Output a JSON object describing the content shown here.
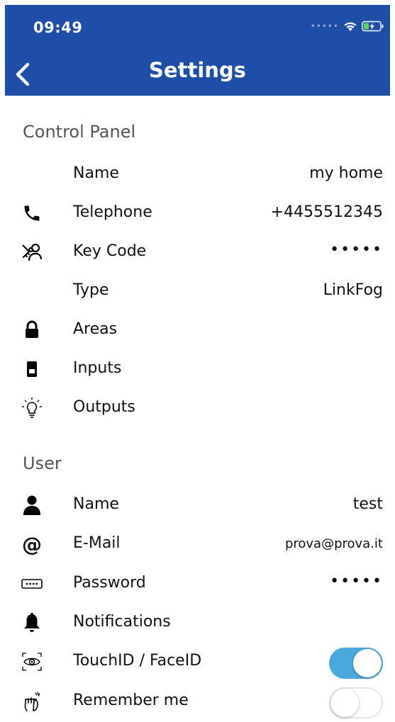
{
  "status_bar": {
    "time": "09:49"
  },
  "nav": {
    "title": "Settings"
  },
  "control_panel": {
    "section_title": "Control Panel",
    "name_label": "Name",
    "name_value": "my home",
    "telephone_label": "Telephone",
    "telephone_value": "+4455512345",
    "keycode_label": "Key Code",
    "keycode_value": "•••••",
    "type_label": "Type",
    "type_value": "LinkFog",
    "areas_label": "Areas",
    "inputs_label": "Inputs",
    "outputs_label": "Outputs"
  },
  "user": {
    "section_title": "User",
    "name_label": "Name",
    "name_value": "test",
    "email_label": "E-Mail",
    "email_value": "prova@prova.it",
    "password_label": "Password",
    "password_value": "•••••",
    "notifications_label": "Notifications",
    "touchid_label": "TouchID / FaceID",
    "touchid_enabled": true,
    "remember_label": "Remember me",
    "remember_enabled": false
  },
  "colors": {
    "nav_bg": "#1f4ea8",
    "toggle_on": "#4aa9dc"
  }
}
